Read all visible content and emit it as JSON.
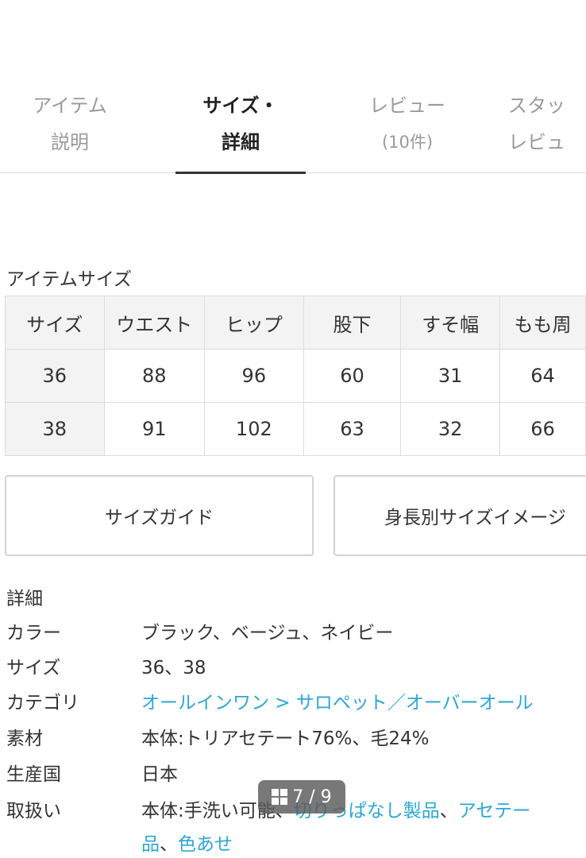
{
  "tabs": [
    {
      "line1": "アイテム",
      "line2": "説明"
    },
    {
      "line1": "サイズ・",
      "line2": "詳細"
    },
    {
      "line1": "レビュー",
      "line2": "(10件)"
    },
    {
      "line1": "スタッ",
      "line2": "レビュ"
    }
  ],
  "item_size": {
    "title": "アイテムサイズ",
    "headers": [
      "サイズ",
      "ウエスト",
      "ヒップ",
      "股下",
      "すそ幅",
      "もも周"
    ],
    "rows": [
      [
        "36",
        "88",
        "96",
        "60",
        "31",
        "64"
      ],
      [
        "38",
        "91",
        "102",
        "63",
        "32",
        "66"
      ]
    ]
  },
  "buttons": {
    "size_guide": "サイズガイド",
    "size_image": "身長別サイズイメージ"
  },
  "details": {
    "title": "詳細",
    "color_label": "カラー",
    "color_value": "ブラック、ベージュ、ネイビー",
    "size_label": "サイズ",
    "size_value": "36、38",
    "category_label": "カテゴリ",
    "category_value": "オールインワン > サロペット／オーバーオール",
    "material_label": "素材",
    "material_value": "本体:トリアセテート76%、毛24%",
    "origin_label": "生産国",
    "origin_value": "日本",
    "care_label": "取扱い",
    "care_value_plain": "本体:手洗い可能、",
    "care_link_1": "切りっぱなし製品",
    "care_sep": "、",
    "care_link_2": "アセテー",
    "care_line2_link_a": "品",
    "care_line2_sep": "、",
    "care_line2_link_b": "色あせ"
  },
  "image_counter": "7 / 9",
  "colors": {
    "link": "#2ba7d6",
    "header_bg": "#f3f3f3",
    "border": "#dcdcdc"
  }
}
